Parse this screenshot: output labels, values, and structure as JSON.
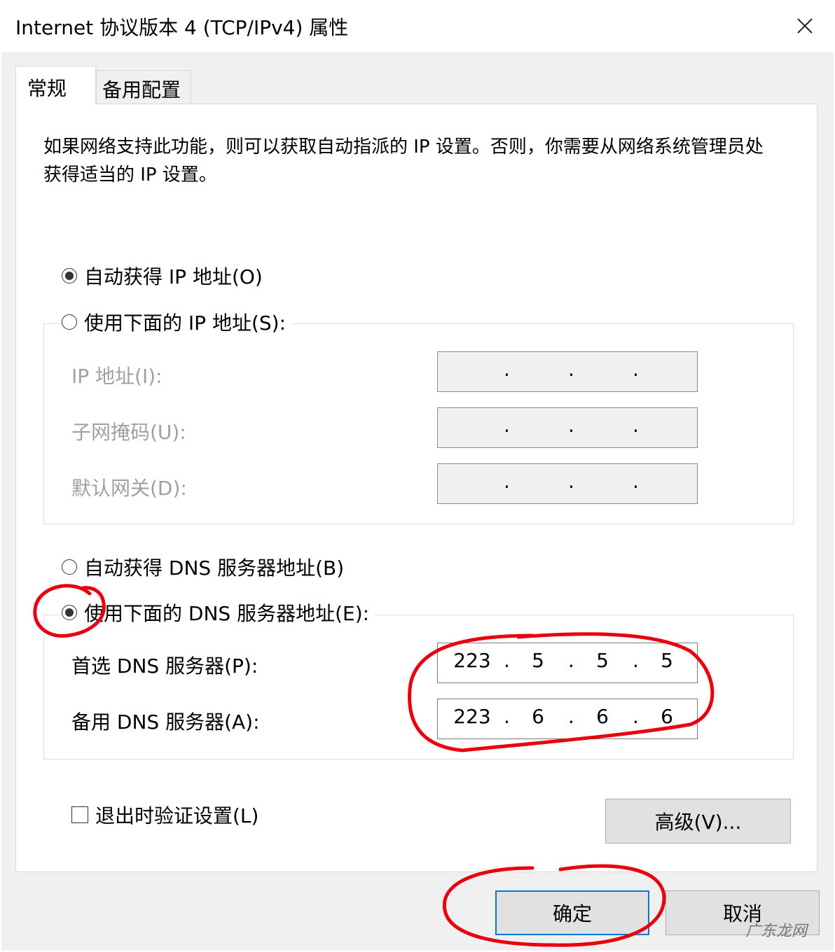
{
  "window": {
    "title": "Internet 协议版本 4 (TCP/IPv4) 属性",
    "close_glyph": "✕"
  },
  "tabs": [
    {
      "label": "常规",
      "active": true
    },
    {
      "label": "备用配置",
      "active": false
    }
  ],
  "description": "如果网络支持此功能，则可以获取自动指派的 IP 设置。否则，你需要从网络系统管理员处获得适当的 IP 设置。",
  "ip_section": {
    "auto_radio": {
      "label": "自动获得 IP 地址(O)",
      "selected": true
    },
    "manual_radio": {
      "label": "使用下面的 IP 地址(S):",
      "selected": false
    },
    "fields": {
      "ip_address": {
        "label": "IP 地址(I):",
        "octets": [
          "",
          "",
          "",
          ""
        ]
      },
      "subnet_mask": {
        "label": "子网掩码(U):",
        "octets": [
          "",
          "",
          "",
          ""
        ]
      },
      "default_gateway": {
        "label": "默认网关(D):",
        "octets": [
          "",
          "",
          "",
          ""
        ]
      }
    }
  },
  "dns_section": {
    "auto_radio": {
      "label": "自动获得 DNS 服务器地址(B)",
      "selected": false
    },
    "manual_radio": {
      "label": "使用下面的 DNS 服务器地址(E):",
      "selected": true
    },
    "fields": {
      "preferred": {
        "label": "首选 DNS 服务器(P):",
        "octets": [
          "223",
          "5",
          "5",
          "5"
        ]
      },
      "alternate": {
        "label": "备用 DNS 服务器(A):",
        "octets": [
          "223",
          "6",
          "6",
          "6"
        ]
      }
    }
  },
  "validate_on_exit": {
    "label": "退出时验证设置(L)",
    "checked": false
  },
  "buttons": {
    "advanced": "高级(V)...",
    "ok": "确定",
    "cancel": "取消"
  },
  "watermark": "广东龙网",
  "colors": {
    "annotation_red": "#e8000f",
    "focus_blue": "#0078d7",
    "disabled_text": "#a0a0a0"
  }
}
